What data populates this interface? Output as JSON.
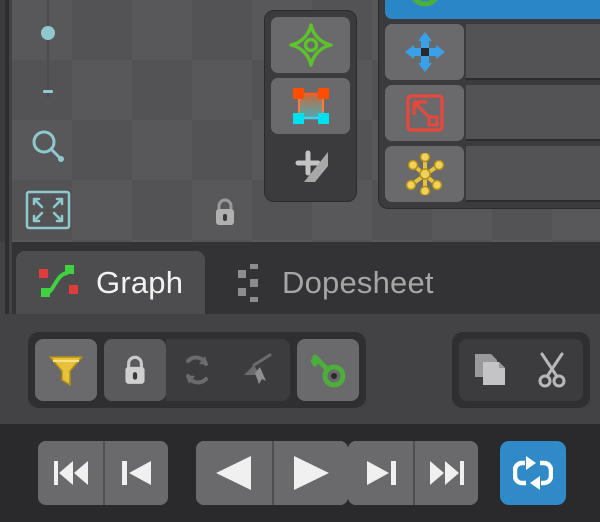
{
  "app": {
    "theme_bg": "#434345",
    "canvas_bg": "#58585b",
    "accent_blue": "#2b86c8",
    "accent_green": "#4caf3c",
    "accent_yellow": "#e8c13a",
    "accent_red": "#e8473a",
    "accent_teal": "#8fc9cd"
  },
  "viewport": {
    "name": "checkerboard-canvas",
    "zoom_slider": {
      "name": "zoom-slider",
      "handle_label": "",
      "minus_label": ""
    },
    "magnifier": {
      "icon": "magnifier-icon"
    },
    "fit_to_screen": {
      "icon": "fit-to-screen-icon"
    },
    "lock": {
      "icon": "lock-icon"
    }
  },
  "tool_rail_left": {
    "buttons": [
      {
        "icon": "pivot-center-icon",
        "label": "Pivot Center",
        "active": true,
        "color": "#5ec22a"
      },
      {
        "icon": "bounding-box-handles-icon",
        "label": "Bounding Box",
        "active": true,
        "color": "#ff5a1f"
      },
      {
        "icon": "add-keyframe-icon",
        "label": "Add Key",
        "active": false,
        "color": "#b8b8b8"
      }
    ]
  },
  "tool_rail_right": {
    "rows": [
      {
        "icon": "record-circle-icon",
        "label": "",
        "selected": true,
        "color": "#4caf3c"
      },
      {
        "icon": "move-arrows-icon",
        "label": "",
        "selected": false,
        "color": "#3aa0e8"
      },
      {
        "icon": "scale-box-icon",
        "label": "",
        "selected": false,
        "color": "#e8473a"
      },
      {
        "icon": "joint-node-icon",
        "label": "",
        "selected": false,
        "color": "#e8c13a"
      }
    ]
  },
  "tabs": [
    {
      "id": "graph",
      "label": "Graph",
      "icon": "graph-curve-icon",
      "active": true
    },
    {
      "id": "dopesheet",
      "label": "Dopesheet",
      "icon": "dopesheet-dots-icon",
      "active": false
    }
  ],
  "toolbar": {
    "left_group": [
      {
        "icon": "filter-funnel-icon",
        "label": "Filter",
        "state": "on",
        "enabled": true
      },
      {
        "icon": "lock-icon",
        "label": "Lock",
        "state": "flat",
        "enabled": true
      },
      {
        "icon": "sync-arrows-icon",
        "label": "Sync",
        "state": "flat",
        "enabled": false
      },
      {
        "icon": "snap-cursor-icon",
        "label": "Snap",
        "state": "flat",
        "enabled": false
      },
      {
        "icon": "key-icon",
        "label": "Key",
        "state": "on",
        "enabled": true
      }
    ],
    "right_group": [
      {
        "icon": "copy-pages-icon",
        "label": "Copy",
        "state": "flat",
        "enabled": false
      },
      {
        "icon": "scissors-icon",
        "label": "Cut",
        "state": "flat",
        "enabled": false
      }
    ]
  },
  "transport": {
    "buttons": [
      {
        "icon": "jump-to-start-icon",
        "label": "Jump to Start",
        "active": false
      },
      {
        "icon": "step-back-icon",
        "label": "Step Back",
        "active": false
      },
      {
        "icon": "play-reverse-icon",
        "label": "Play Reverse",
        "active": false
      },
      {
        "icon": "play-icon",
        "label": "Play",
        "active": false
      },
      {
        "icon": "step-forward-icon",
        "label": "Step Forward",
        "active": false
      },
      {
        "icon": "jump-to-end-icon",
        "label": "Jump to End",
        "active": false
      }
    ],
    "loop": {
      "icon": "loop-repeat-icon",
      "label": "Loop",
      "active": true,
      "color": "#2f8ac7"
    }
  }
}
